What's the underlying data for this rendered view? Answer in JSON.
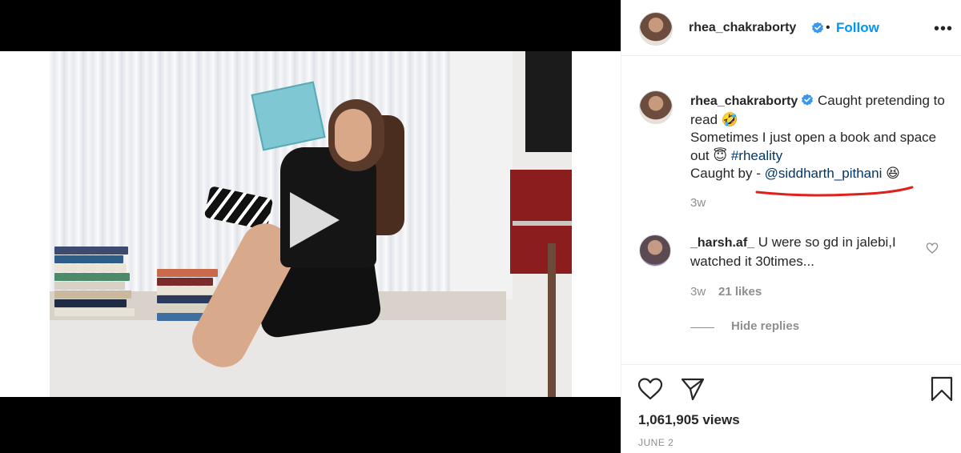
{
  "post": {
    "username": "rhea_chakraborty",
    "separator": "•",
    "follow_label": "Follow",
    "more_label": "•••",
    "caption": {
      "username": "rhea_chakraborty",
      "line1": "Caught pretending to read",
      "emoji1": "🤣",
      "line2": "Sometimes I just open a book and space out",
      "emoji2": "😇",
      "hashtag": "#rheality",
      "line3_prefix": "Caught by -",
      "mention": "@siddharth_pithani",
      "emoji3": "😆",
      "age": "3w"
    },
    "comment": {
      "username": "_harsh.af_",
      "text": "U were so gd in jalebi,I watched it 30times...",
      "age": "3w",
      "likes": "21 likes",
      "hide_replies_label": "Hide replies"
    },
    "views": "1,061,905 views",
    "date": "JUNE 2"
  },
  "colors": {
    "follow_blue": "#0095f6",
    "link_blue": "#00376b",
    "annotation_red": "#e0201b",
    "verified_blue": "#3897f0"
  },
  "icons": {
    "play": "play-icon",
    "like": "heart-icon",
    "share": "send-icon",
    "save": "bookmark-icon",
    "verified": "verified-badge-icon",
    "more": "more-options-icon"
  }
}
